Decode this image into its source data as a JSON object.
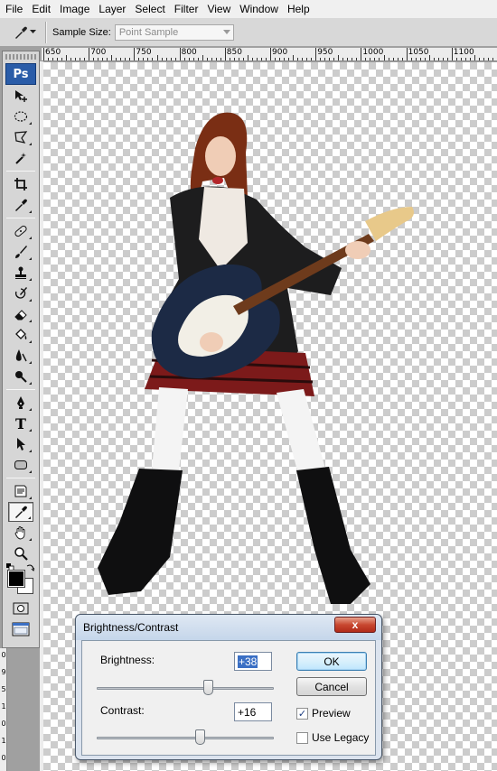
{
  "menu": [
    "File",
    "Edit",
    "Image",
    "Layer",
    "Select",
    "Filter",
    "View",
    "Window",
    "Help"
  ],
  "options_bar": {
    "sample_size_label": "Sample Size:",
    "sample_size_value": "Point Sample"
  },
  "ruler": {
    "h_labels": [
      "650",
      "700",
      "750",
      "800",
      "850",
      "900",
      "950",
      "1000",
      "1050",
      "1100"
    ],
    "v_labels": [
      "0",
      "9",
      "5",
      "1",
      "0",
      "1",
      "0"
    ]
  },
  "toolbox": {
    "logo": "Ps",
    "tools": [
      "move-tool",
      "lasso-marquee-tool",
      "polygonal-lasso-tool",
      "magic-wand-tool",
      "crop-tool",
      "eyedropper-tool",
      "healing-brush-tool",
      "brush-tool",
      "clone-stamp-tool",
      "history-brush-tool",
      "eraser-tool",
      "paint-bucket-tool",
      "blur-tool",
      "dodge-tool",
      "pen-tool",
      "type-tool",
      "path-selection-tool",
      "rectangle-shape-tool",
      "notes-tool",
      "color-sampler-tool",
      "hand-tool",
      "zoom-tool"
    ],
    "type_tool_glyph": "T",
    "foreground_color": "#000000",
    "background_color": "#ffffff"
  },
  "dialog": {
    "title": "Brightness/Contrast",
    "close_glyph": "x",
    "brightness_label": "Brightness:",
    "brightness_value": "+38",
    "brightness_level": 38,
    "contrast_label": "Contrast:",
    "contrast_value": "+16",
    "contrast_level": 16,
    "ok_label": "OK",
    "cancel_label": "Cancel",
    "preview_label": "Preview",
    "preview_checked": true,
    "legacy_label": "Use Legacy",
    "legacy_checked": false,
    "check_glyph": "✓"
  }
}
